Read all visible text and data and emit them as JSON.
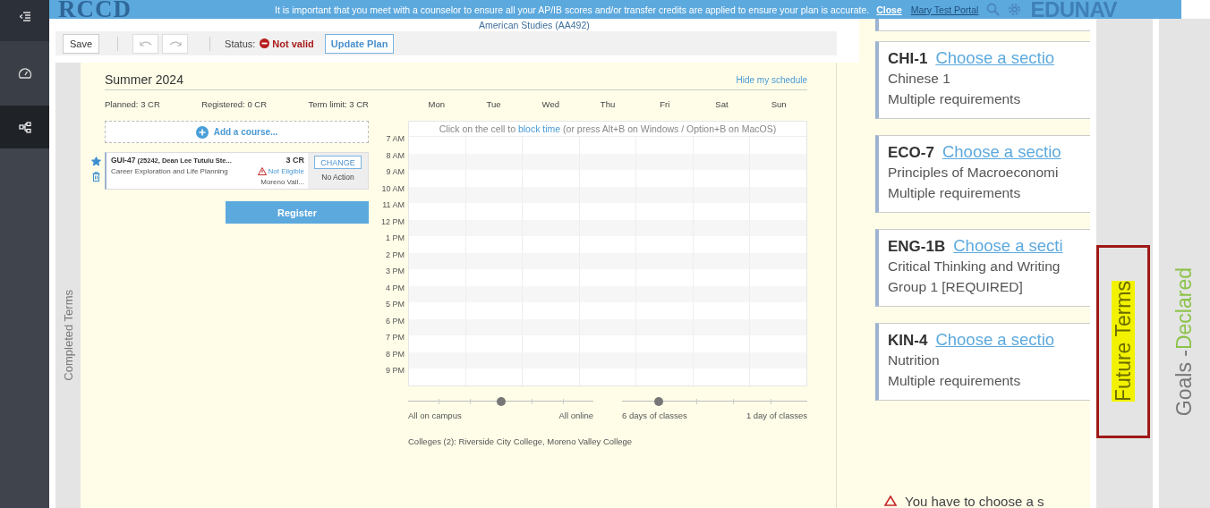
{
  "sidebar": {
    "items": [
      {
        "kind": "menu",
        "selected": false
      },
      {
        "kind": "dashboard",
        "selected": false
      },
      {
        "kind": "tree",
        "selected": true
      }
    ]
  },
  "banner": {
    "logo": "RCCD",
    "message": "It is important that you meet with a counselor to ensure all your AP/IB scores and/or transfer credits are applied to ensure your plan is accurate.",
    "close": "Close",
    "user": "Mary Test Portal",
    "brand": "EDUNAV"
  },
  "plan_title": "American Studies (AA492)",
  "toolbar": {
    "save": "Save",
    "undo": {
      "disabled": true
    },
    "redo": {
      "disabled": true
    },
    "status_label": "Status:",
    "status": "Not valid",
    "status_valid": false,
    "update": "Update Plan"
  },
  "completed_tab": {
    "label": "Completed Terms",
    "selected": false
  },
  "term": {
    "title": "Summer 2024",
    "hide_link": "Hide my schedule",
    "stats": [
      "Planned: 3 CR",
      "Registered: 0 CR",
      "Term limit: 3 CR"
    ],
    "add_course": "Add a course...",
    "courses": [
      {
        "code": "GUI-47",
        "section": "(25242, Dean Lee Tutulu Ste...",
        "credits": "3 CR",
        "title": "Career Exploration and Life Planning",
        "eligibility": "Not Eligible",
        "eligible": false,
        "campus": "Moreno Vall...",
        "action_button": "CHANGE",
        "action_status": "No Action",
        "favorite": true
      }
    ],
    "register": "Register"
  },
  "calendar": {
    "days": [
      "Mon",
      "Tue",
      "Wed",
      "Thu",
      "Fri",
      "Sat",
      "Sun"
    ],
    "hint": "Click on the cell to",
    "hint_link": "block time",
    "hint_rest": "(or press Alt+B on Windows / Option+B on MacOS)",
    "times": [
      "7 AM",
      "8 AM",
      "9 AM",
      "10 AM",
      "11 AM",
      "12 PM",
      "1 PM",
      "2 PM",
      "3 PM",
      "4 PM",
      "5 PM",
      "6 PM",
      "7 PM",
      "8 PM",
      "9 PM"
    ],
    "sliders": [
      {
        "min_label": "All on campus",
        "max_label": "All online",
        "level": 0.5
      },
      {
        "min_label": "6 days of classes",
        "max_label": "1 day of classes",
        "level": 0.2
      }
    ],
    "colleges": "Colleges (2): Riverside City College, Moreno Valley College"
  },
  "cards": [
    {
      "code": "CHI-1",
      "link": "Choose a sectio",
      "title": "Chinese 1",
      "requirement": "Multiple requirements"
    },
    {
      "code": "ECO-7",
      "link": "Choose a sectio",
      "title": "Principles of Macroeconomi",
      "requirement": "Multiple requirements"
    },
    {
      "code": "ENG-1B",
      "link": "Choose a secti",
      "title": "Critical Thinking and Writing",
      "requirement": "Group 1 [REQUIRED]"
    },
    {
      "code": "KIN-4",
      "link": "Choose a sectio",
      "title": "Nutrition",
      "requirement": "Multiple requirements"
    }
  ],
  "warning": "You have to choose a s",
  "side_tabs": [
    {
      "label": "Future Terms",
      "selected": true
    },
    {
      "label": "Goals -",
      "status": "Declared",
      "selected": false
    }
  ]
}
